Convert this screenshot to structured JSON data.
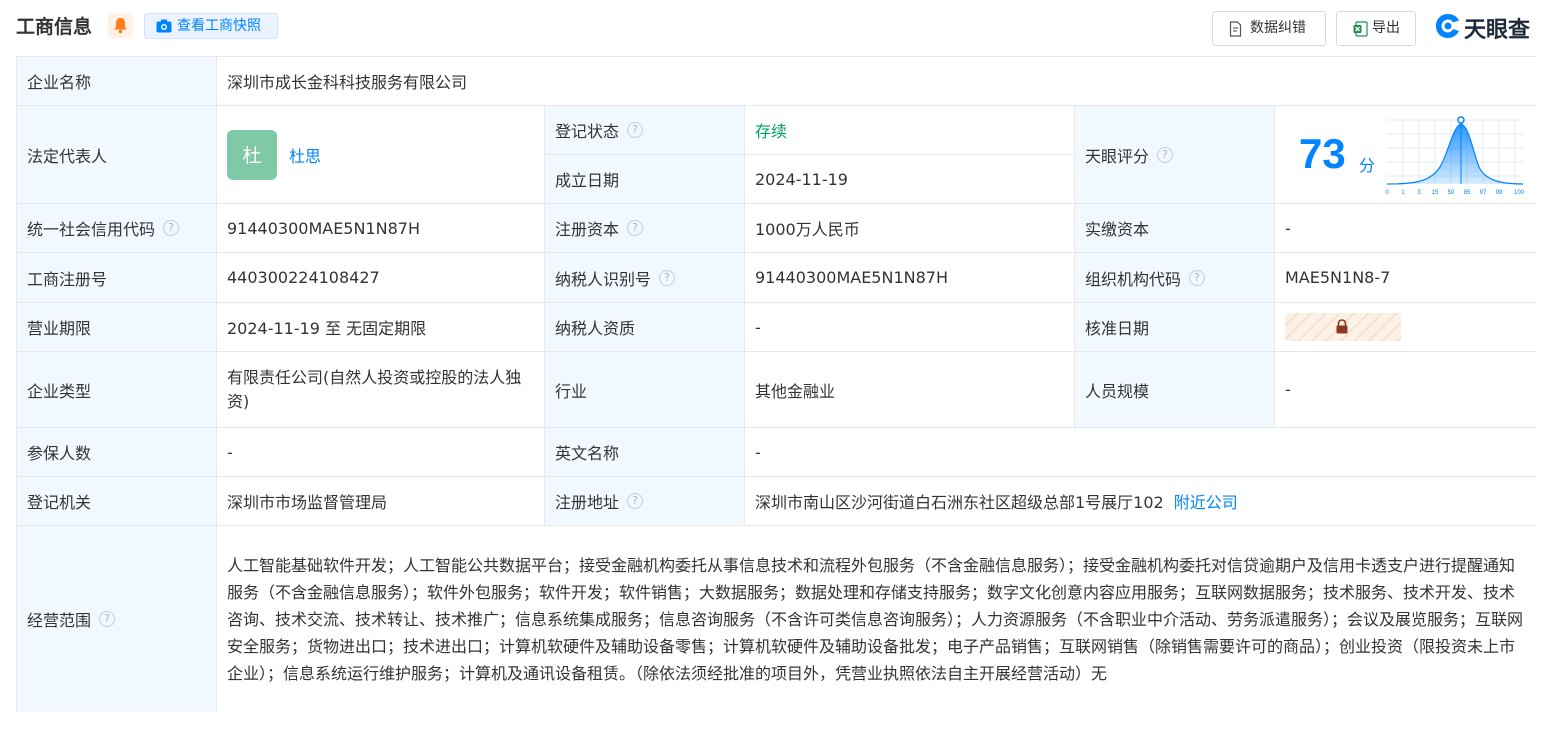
{
  "header": {
    "title": "工商信息",
    "snapshot_label": "查看工商快照",
    "correct_label": "数据纠错",
    "export_label": "导出",
    "brand": "天眼查"
  },
  "rows": {
    "company_name": {
      "label": "企业名称",
      "value": "深圳市成长金科科技服务有限公司"
    },
    "legal_rep": {
      "label": "法定代表人",
      "avatar": "杜",
      "name": "杜思"
    },
    "reg_status": {
      "label": "登记状态",
      "value": "存续"
    },
    "found_date": {
      "label": "成立日期",
      "value": "2024-11-19"
    },
    "score": {
      "label": "天眼评分",
      "value": "73",
      "unit": "分",
      "axis_ticks": [
        "0",
        "1",
        "3",
        "15",
        "50",
        "85",
        "97",
        "99",
        "100"
      ]
    },
    "credit_code": {
      "label": "统一社会信用代码",
      "value": "91440300MAE5N1N87H"
    },
    "reg_capital": {
      "label": "注册资本",
      "value": "1000万人民币"
    },
    "paid_capital": {
      "label": "实缴资本",
      "value": "-"
    },
    "reg_no": {
      "label": "工商注册号",
      "value": "440300224108427"
    },
    "taxpayer_id": {
      "label": "纳税人识别号",
      "value": "91440300MAE5N1N87H"
    },
    "org_code": {
      "label": "组织机构代码",
      "value": "MAE5N1N8-7"
    },
    "term": {
      "label": "营业期限",
      "value": "2024-11-19 至 无固定期限"
    },
    "taxpayer_qual": {
      "label": "纳税人资质",
      "value": "-"
    },
    "approve_date": {
      "label": "核准日期"
    },
    "company_type": {
      "label": "企业类型",
      "value": "有限责任公司(自然人投资或控股的法人独资)"
    },
    "industry": {
      "label": "行业",
      "value": "其他金融业"
    },
    "staff_size": {
      "label": "人员规模",
      "value": "-"
    },
    "insured": {
      "label": "参保人数",
      "value": "-"
    },
    "english_name": {
      "label": "英文名称",
      "value": "-"
    },
    "authority": {
      "label": "登记机关",
      "value": "深圳市市场监督管理局"
    },
    "address": {
      "label": "注册地址",
      "value": "深圳市南山区沙河街道白石洲东社区超级总部1号展厅102",
      "nearby": "附近公司"
    },
    "scope": {
      "label": "经营范围",
      "value": "人工智能基础软件开发；人工智能公共数据平台；接受金融机构委托从事信息技术和流程外包服务（不含金融信息服务）；接受金融机构委托对信贷逾期户及信用卡透支户进行提醒通知服务（不含金融信息服务）；软件外包服务；软件开发；软件销售；大数据服务；数据处理和存储支持服务；数字文化创意内容应用服务；互联网数据服务；技术服务、技术开发、技术咨询、技术交流、技术转让、技术推广；信息系统集成服务；信息咨询服务（不含许可类信息咨询服务）；人力资源服务（不含职业中介活动、劳务派遣服务）；会议及展览服务；互联网安全服务；货物进出口；技术进出口；计算机软硬件及辅助设备零售；计算机软硬件及辅助设备批发；电子产品销售；互联网销售（除销售需要许可的商品）；创业投资（限投资未上市企业）；信息系统运行维护服务；计算机及通讯设备租赁。（除依法须经批准的项目外，凭营业执照依法自主开展经营活动）无"
    }
  },
  "help_glyph": "?",
  "colors": {
    "accent": "#0084ff",
    "label_bg": "#f2f8ff",
    "status_green": "#00a15f",
    "border": "#e8e8e8"
  }
}
